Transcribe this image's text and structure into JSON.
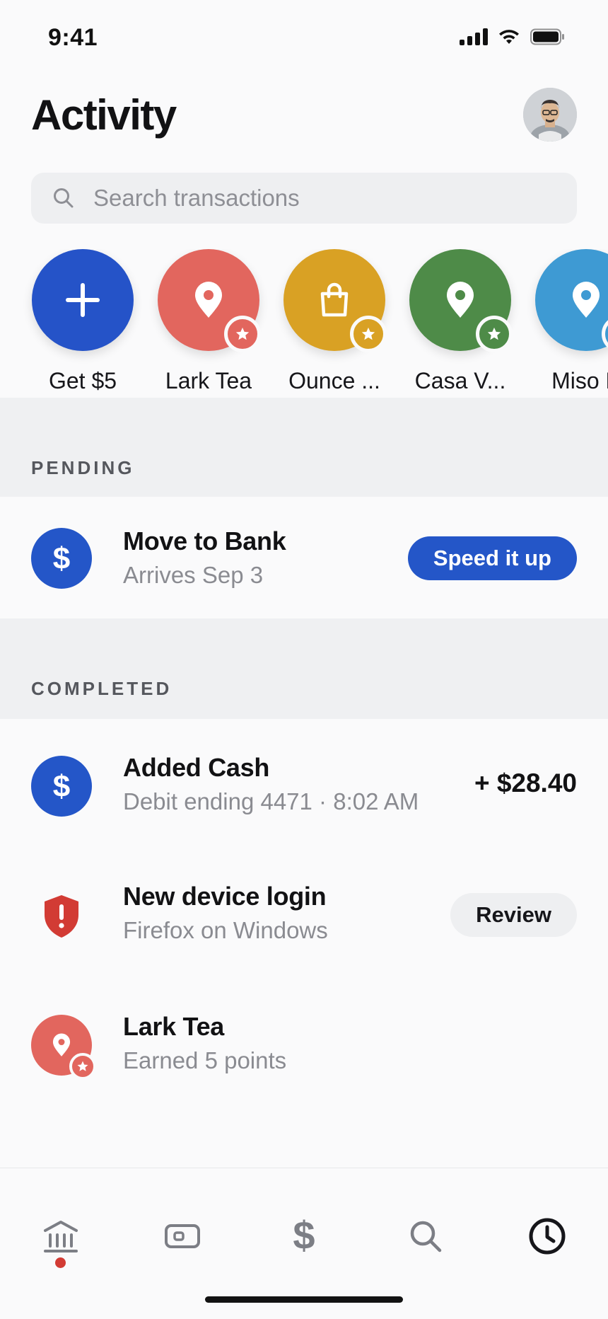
{
  "status_bar": {
    "time": "9:41"
  },
  "header": {
    "title": "Activity",
    "avatar_icon": "person-avatar"
  },
  "search": {
    "placeholder": "Search transactions",
    "icon": "search-icon"
  },
  "quick_actions": [
    {
      "label": "Get $5",
      "color": "#2553c8",
      "icon": "plus-icon"
    },
    {
      "label": "Lark Tea",
      "color": "#e2665e",
      "icon": "location-pin-icon",
      "badge": "star-icon"
    },
    {
      "label": "Ounce ...",
      "color": "#d9a124",
      "icon": "shopping-bag-icon",
      "badge": "star-icon"
    },
    {
      "label": "Casa V...",
      "color": "#4e8b48",
      "icon": "location-pin-icon",
      "badge": "star-icon"
    },
    {
      "label": "Miso B",
      "color": "#3e9ad3",
      "icon": "location-pin-icon",
      "badge": "star-icon"
    }
  ],
  "pending": {
    "section_label": "PENDING",
    "item": {
      "title": "Move to Bank",
      "subtitle": "Arrives Sep 3",
      "action": "Speed it up",
      "icon": "dollar-icon",
      "icon_color": "#2456c8"
    }
  },
  "completed": {
    "section_label": "COMPLETED",
    "items": [
      {
        "title": "Added Cash",
        "subtitle": "Debit ending 4471 · 8:02 AM",
        "amount": "+ $28.40",
        "icon": "dollar-icon",
        "icon_color": "#2456c8"
      },
      {
        "title": "New device login",
        "subtitle": "Firefox on Windows",
        "action": "Review",
        "icon": "shield-alert-icon",
        "icon_color": "#d23b34"
      },
      {
        "title": "Lark Tea",
        "subtitle": "Earned 5 points",
        "icon": "location-pin-icon",
        "icon_color": "#e2665e",
        "badge": "star-icon"
      }
    ]
  },
  "tab_bar": {
    "tabs": [
      {
        "name": "bank-icon",
        "notification_dot": true
      },
      {
        "name": "card-icon"
      },
      {
        "name": "dollar-icon"
      },
      {
        "name": "search-icon"
      },
      {
        "name": "clock-icon",
        "active": true
      }
    ],
    "active_color": "#16161a",
    "inactive_color": "#7c7e85",
    "dot_color": "#d23b34"
  }
}
